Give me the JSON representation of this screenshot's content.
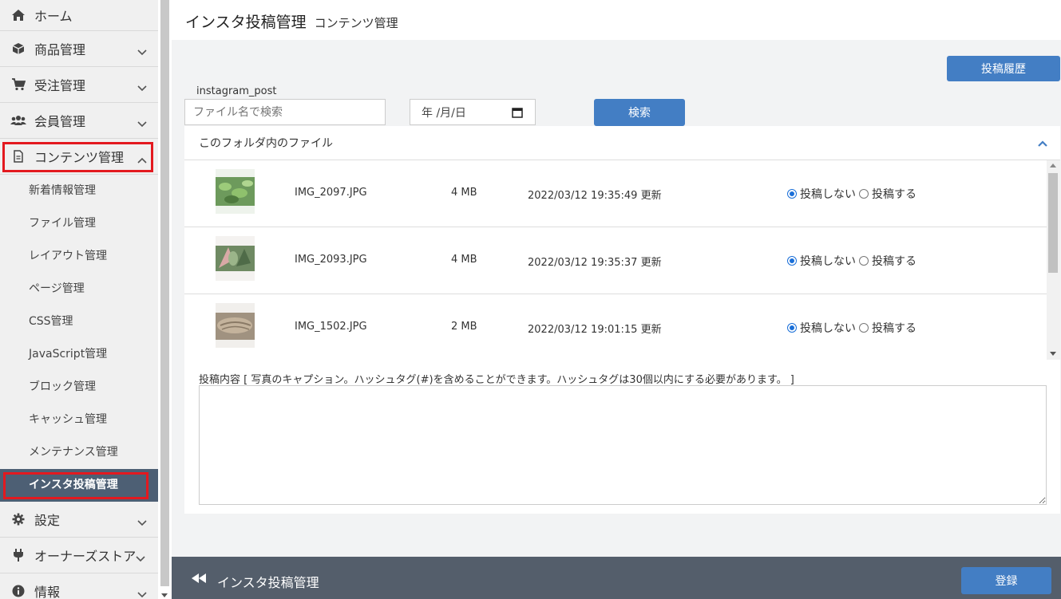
{
  "sidebar": {
    "items": [
      {
        "label": "ホーム",
        "icon": "home-icon"
      },
      {
        "label": "商品管理",
        "icon": "cube-icon"
      },
      {
        "label": "受注管理",
        "icon": "cart-icon"
      },
      {
        "label": "会員管理",
        "icon": "users-icon"
      },
      {
        "label": "コンテンツ管理",
        "icon": "file-icon"
      }
    ],
    "sub_items": [
      "新着情報管理",
      "ファイル管理",
      "レイアウト管理",
      "ページ管理",
      "CSS管理",
      "JavaScript管理",
      "ブロック管理",
      "キャッシュ管理",
      "メンテナンス管理",
      "インスタ投稿管理"
    ],
    "bottom_items": [
      {
        "label": "設定",
        "icon": "gear-icon"
      },
      {
        "label": "オーナーズストア",
        "icon": "plug-icon"
      },
      {
        "label": "情報",
        "icon": "info-icon"
      }
    ]
  },
  "header": {
    "title": "インスタ投稿管理",
    "subtitle": "コンテンツ管理"
  },
  "toolbar": {
    "history_label": "投稿履歴",
    "folder_label": "instagram_post",
    "search_placeholder": "ファイル名で検索",
    "date_placeholder": "年 /月/日",
    "search_label": "検索"
  },
  "panel": {
    "title": "このフォルダ内のファイル",
    "files": [
      {
        "name": "IMG_2097.JPG",
        "size": "4 MB",
        "date": "2022/03/12 19:35:49 更新",
        "option_no": "投稿しない",
        "option_yes": "投稿する"
      },
      {
        "name": "IMG_2093.JPG",
        "size": "4 MB",
        "date": "2022/03/12 19:35:37 更新",
        "option_no": "投稿しない",
        "option_yes": "投稿する"
      },
      {
        "name": "IMG_1502.JPG",
        "size": "2 MB",
        "date": "2022/03/12 19:01:15 更新",
        "option_no": "投稿しない",
        "option_yes": "投稿する"
      }
    ],
    "caption_label": "投稿内容 [ 写真のキャプション。ハッシュタグ(#)を含めることができます。ハッシュタグは30個以内にする必要があります。 ]"
  },
  "footer": {
    "title": "インスタ投稿管理",
    "register_label": "登録"
  },
  "colors": {
    "primary": "#437ec4",
    "sidebar_active": "#4d5f74",
    "footer": "#545e6b",
    "highlight": "#e3191f"
  }
}
